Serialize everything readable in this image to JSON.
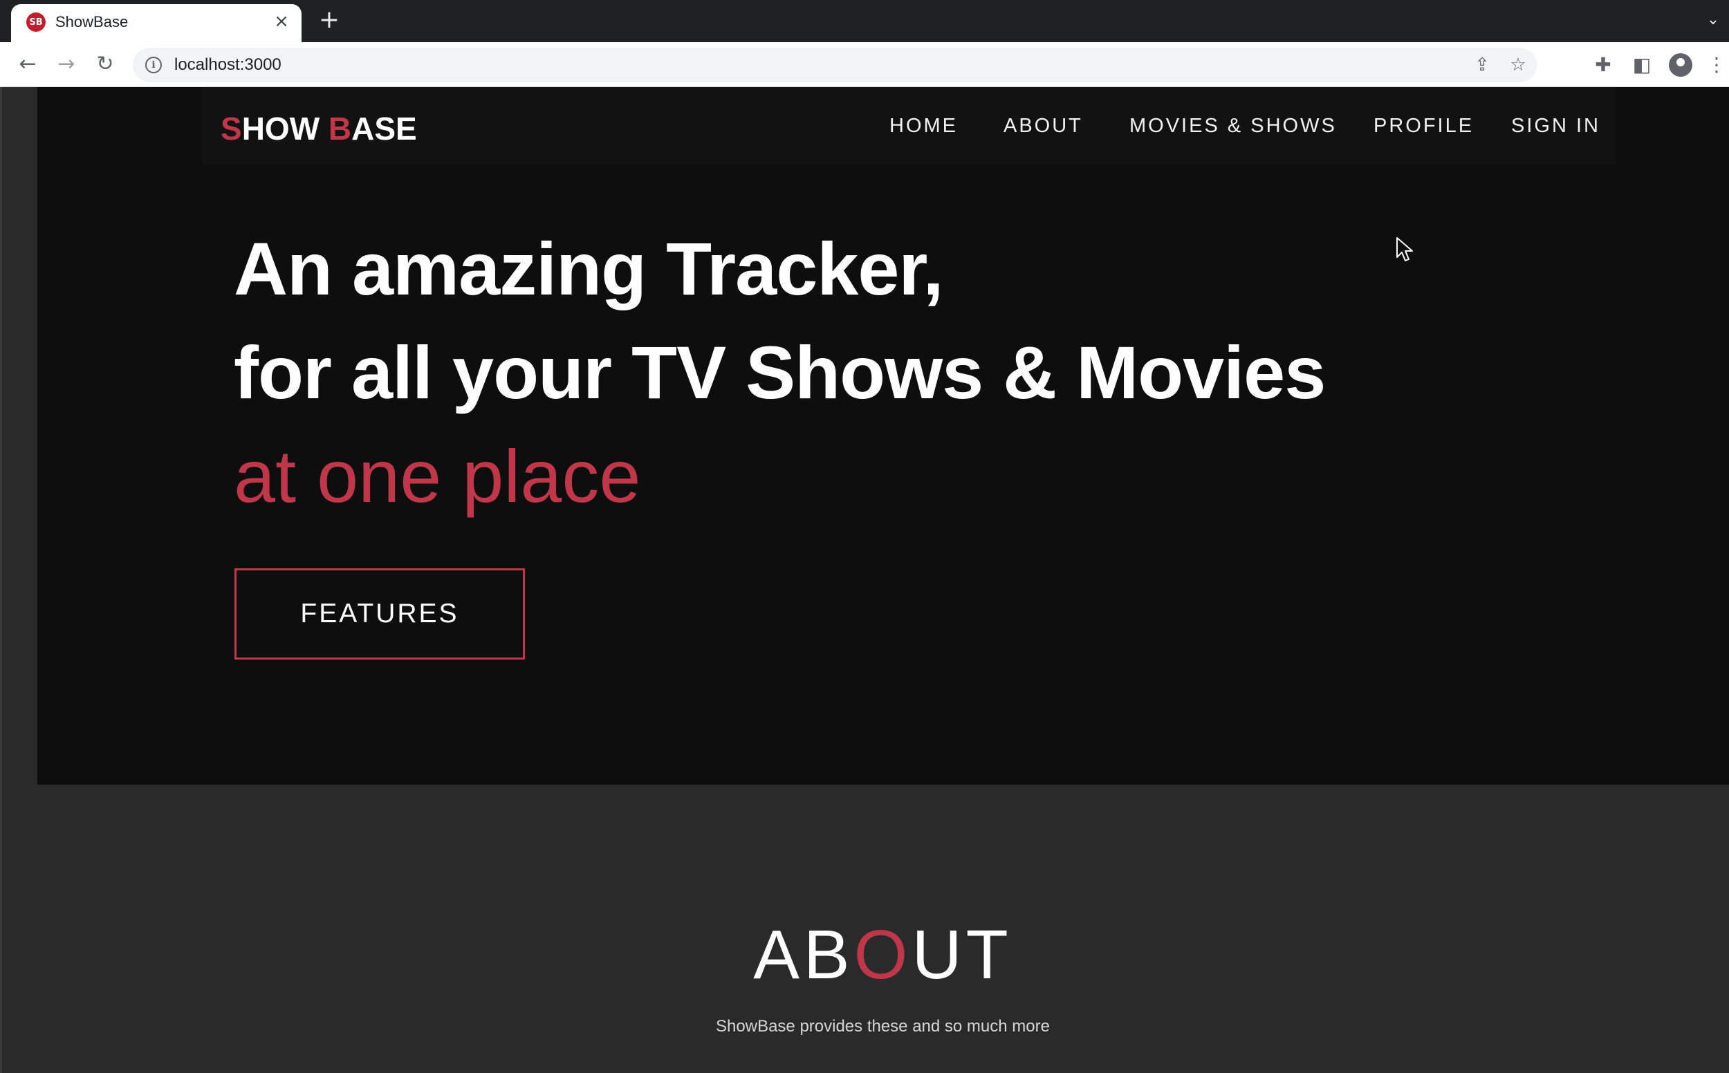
{
  "browser": {
    "tab_title": "ShowBase",
    "favicon_text": "SB",
    "tab_close": "×",
    "new_tab": "+",
    "tab_search": "⌄",
    "back": "←",
    "forward": "→",
    "reload": "↻",
    "url": "localhost:3000",
    "info_icon": "i",
    "share": "⇪",
    "bookmark": "☆",
    "extensions": "✚",
    "side_panel": "◧",
    "menu": "⋮"
  },
  "navbar": {
    "logo": {
      "s": "S",
      "how": "HOW ",
      "b": "B",
      "ase": "ASE"
    },
    "links": [
      "HOME",
      "ABOUT",
      "MOVIES & SHOWS",
      "PROFILE",
      "SIGN IN"
    ]
  },
  "hero": {
    "line1": "An amazing Tracker,",
    "line2": "for all your TV Shows & Movies",
    "line3": "at one place",
    "cta_label": "FEATURES"
  },
  "about": {
    "title_pre": "AB",
    "title_accent": "O",
    "title_post": "UT",
    "subtitle": "ShowBase provides these and so much more"
  },
  "colors": {
    "accent": "#c0374a",
    "hero_bg": "#0e0e0f",
    "page_bg": "#2a2a2b"
  }
}
